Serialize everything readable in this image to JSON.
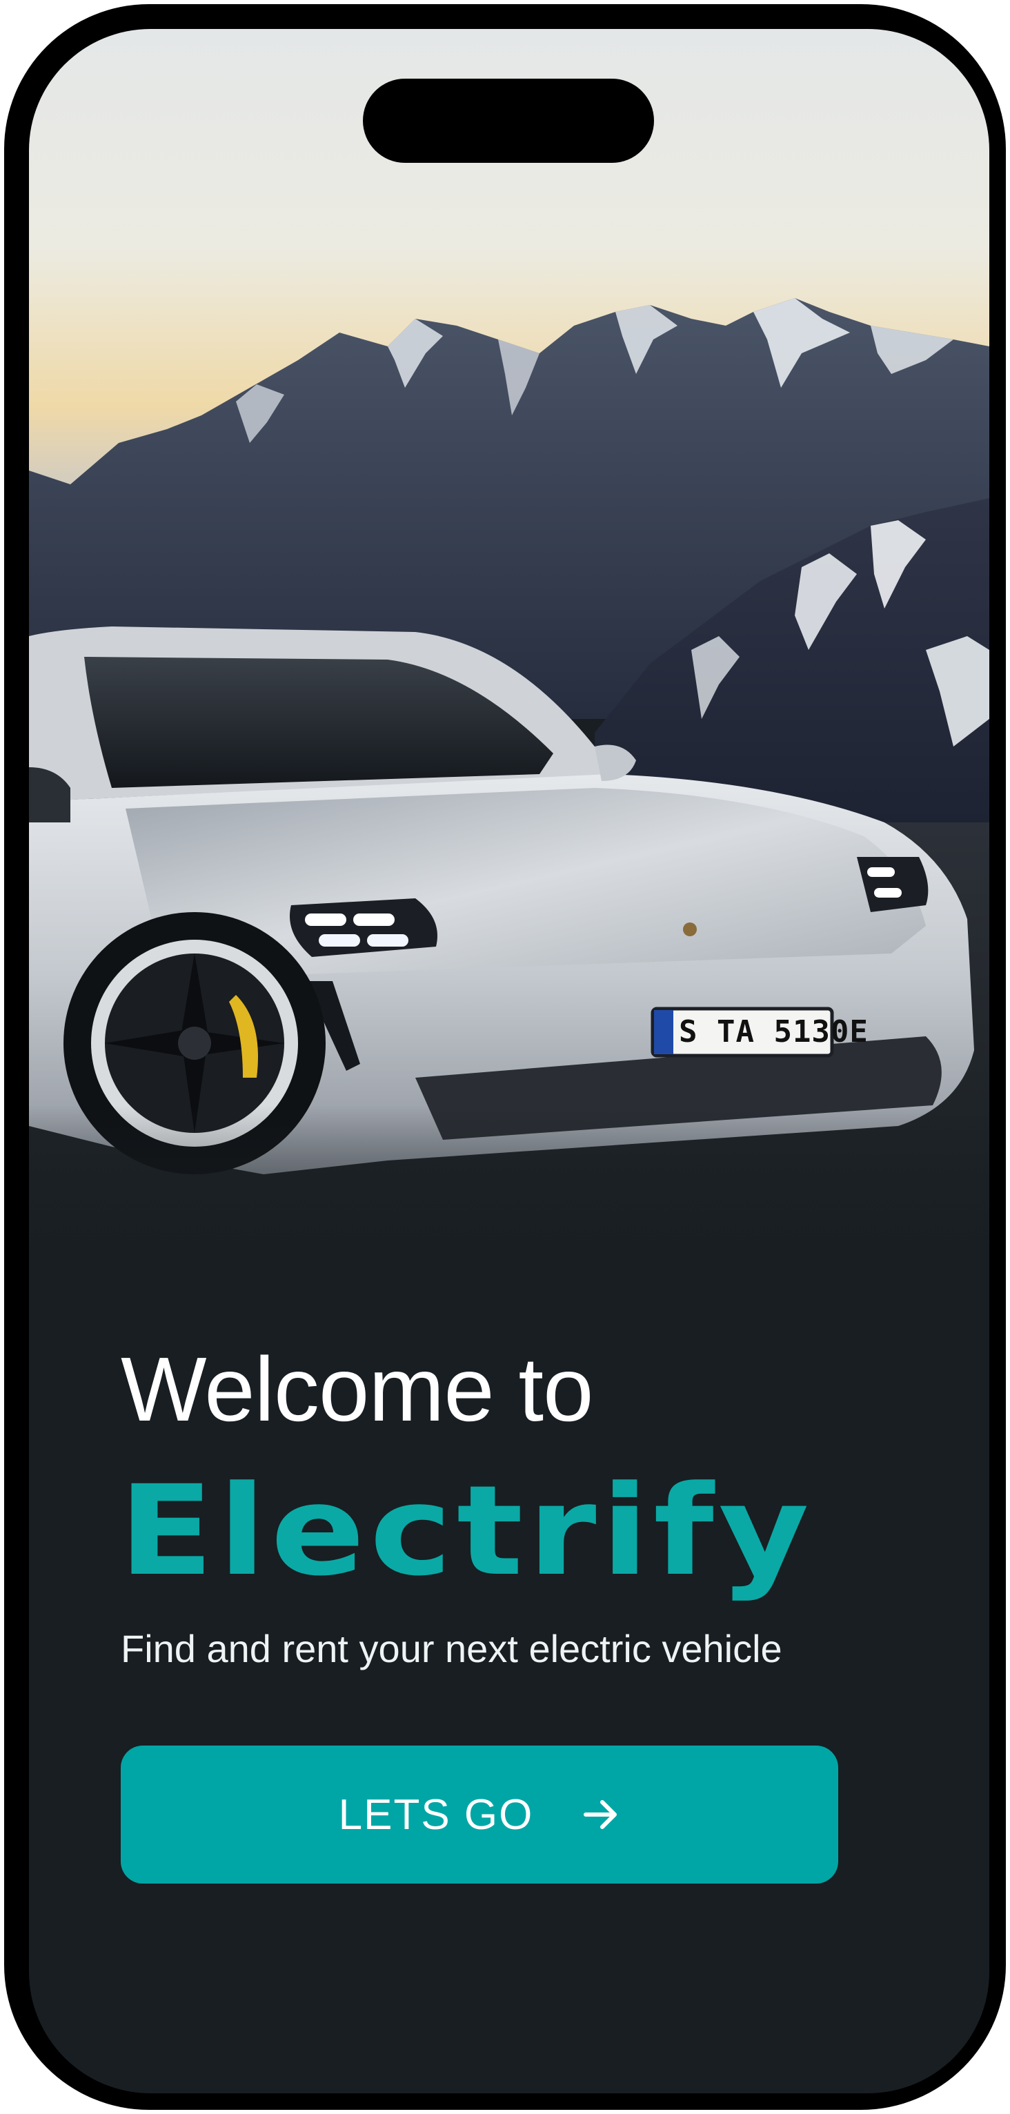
{
  "welcome": {
    "heading_line1": "Welcome to",
    "brand_name": "Electrify",
    "tagline": "Find and rent your next electric vehicle",
    "cta_label": "LETS GO",
    "cta_icon": "arrow-right-icon"
  },
  "hero": {
    "license_plate": "S TA 5130E",
    "image_subject": "white-electric-sports-car-mountains"
  },
  "colors": {
    "brand_accent": "#0aa9a5",
    "button_background": "#00a6a6",
    "screen_background": "#181e22",
    "frame": "#000000"
  }
}
